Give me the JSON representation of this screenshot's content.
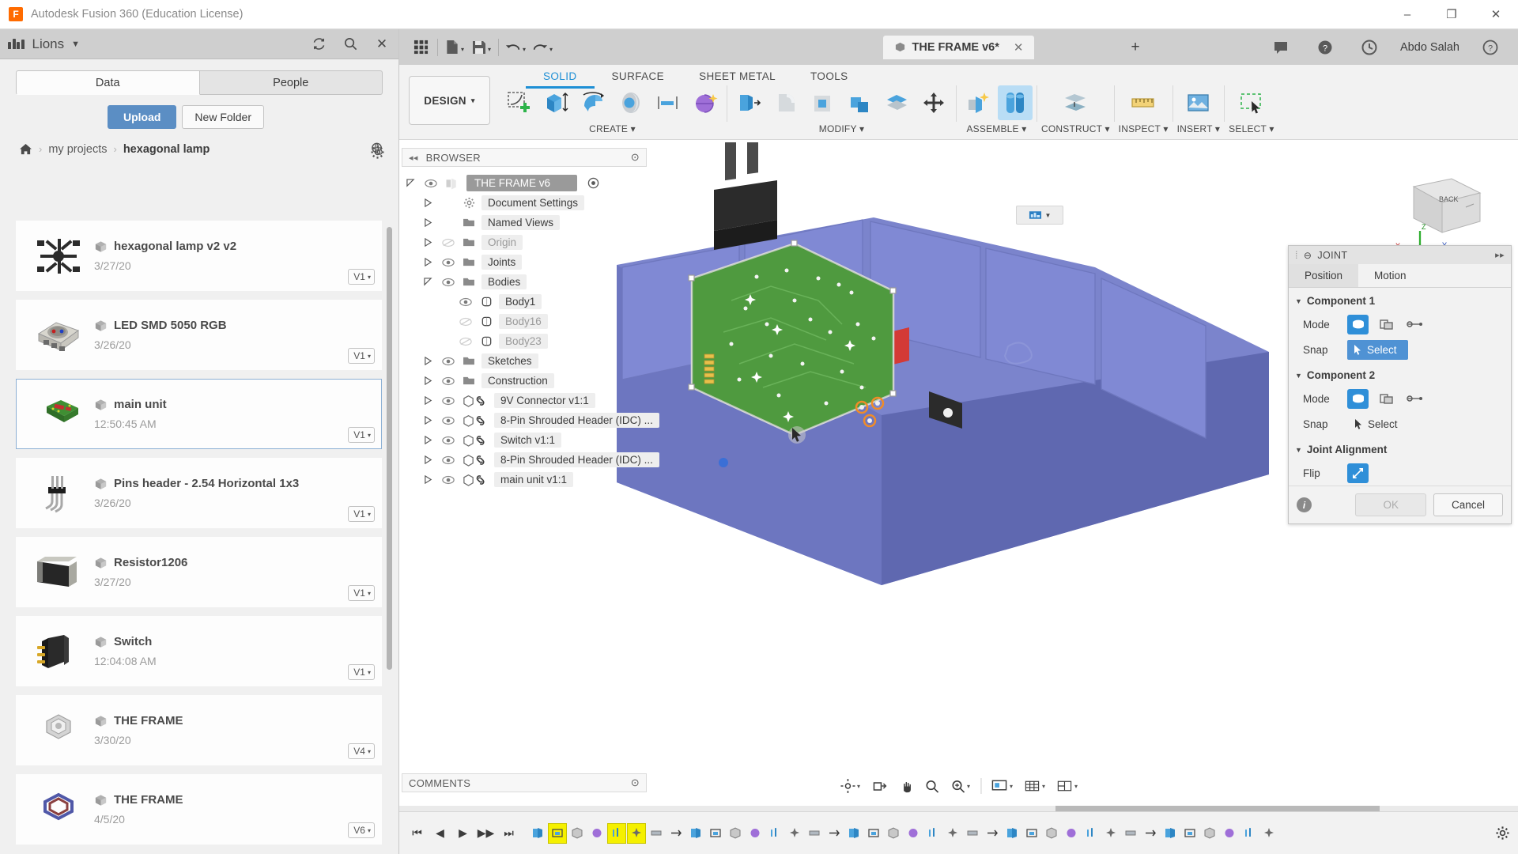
{
  "titlebar": {
    "app_title": "Autodesk Fusion 360 (Education License)",
    "logo_letter": "F",
    "minimize": "–",
    "maximize": "❐",
    "close": "✕"
  },
  "data_panel": {
    "hub_name": "Lions",
    "hub_caret": "▼",
    "refresh_icon": "refresh-icon",
    "search_icon": "search-icon",
    "close_icon": "✕",
    "tabs": [
      {
        "label": "Data",
        "active": true
      },
      {
        "label": "People",
        "active": false
      }
    ],
    "upload_label": "Upload",
    "new_folder_label": "New Folder",
    "breadcrumb": {
      "home": "⌂",
      "sep": "›",
      "project": "my projects",
      "current": "hexagonal lamp"
    },
    "items": [
      {
        "name": "hexagonal lamp v2 v2",
        "date": "3/27/20",
        "version": "V1",
        "selected": false,
        "thumb": "spider-assembly"
      },
      {
        "name": "LED SMD 5050 RGB",
        "date": "3/26/20",
        "version": "V1",
        "selected": false,
        "thumb": "led-package"
      },
      {
        "name": "main unit",
        "date": "12:50:45 AM",
        "version": "V1",
        "selected": true,
        "thumb": "green-pcb"
      },
      {
        "name": "Pins header - 2.54 Horizontal 1x3",
        "date": "3/26/20",
        "version": "V1",
        "selected": false,
        "thumb": "pin-header"
      },
      {
        "name": "Resistor1206",
        "date": "3/27/20",
        "version": "V1",
        "selected": false,
        "thumb": "resistor"
      },
      {
        "name": "Switch",
        "date": "12:04:08 AM",
        "version": "V1",
        "selected": false,
        "thumb": "switch"
      },
      {
        "name": "THE FRAME",
        "date": "3/30/20",
        "version": "V4",
        "selected": false,
        "thumb": "hex-frame-grey"
      },
      {
        "name": "THE FRAME",
        "date": "4/5/20",
        "version": "V6",
        "selected": false,
        "thumb": "hex-frame-blue"
      }
    ],
    "version_caret": "▾"
  },
  "quick_access": {
    "grid_icon": "grid-apps-icon",
    "new_icon": "new-document-icon",
    "save_icon": "save-icon",
    "undo_icon": "undo-icon",
    "redo_icon": "redo-icon",
    "document_tab": "THE FRAME v6*",
    "tab_close": "✕",
    "tab_add": "+",
    "comment_icon": "comment-icon",
    "help_icon": "help-icon",
    "notification_icon": "notification-icon",
    "user_name": "Abdo Salah",
    "user_help_icon": "question-icon"
  },
  "ribbon": {
    "workspace_label": "DESIGN",
    "workspace_caret": "▾",
    "tabs": [
      {
        "label": "SOLID",
        "active": true
      },
      {
        "label": "SURFACE",
        "active": false
      },
      {
        "label": "SHEET METAL",
        "active": false
      },
      {
        "label": "TOOLS",
        "active": false
      }
    ],
    "groups": [
      {
        "label": "CREATE ▾",
        "icons": [
          "sketch-create-icon",
          "extrude-icon",
          "revolve-icon",
          "sweep-icon",
          "rib-icon",
          "pattern-sphere-icon"
        ]
      },
      {
        "label": "MODIFY ▾",
        "icons": [
          "press-pull-icon",
          "fillet-icon",
          "shell-icon",
          "combine-icon",
          "offset-face-icon",
          "move-copy-icon"
        ]
      },
      {
        "label": "ASSEMBLE ▾",
        "icons": [
          "new-component-icon",
          "joint-icon"
        ]
      },
      {
        "label": "CONSTRUCT ▾",
        "icons": [
          "offset-plane-icon"
        ]
      },
      {
        "label": "INSPECT ▾",
        "icons": [
          "measure-icon"
        ]
      },
      {
        "label": "INSERT ▾",
        "icons": [
          "insert-image-icon"
        ]
      },
      {
        "label": "SELECT ▾",
        "icons": [
          "select-icon"
        ]
      }
    ]
  },
  "browser": {
    "title": "BROWSER",
    "collapse_icon": "◂◂",
    "settings_dot": "⊙",
    "tree": [
      {
        "label": "THE FRAME v6",
        "indent": 0,
        "arrow": "open",
        "eye": "on",
        "icon": "component-icon",
        "root": true,
        "dim": false
      },
      {
        "label": "Document Settings",
        "indent": 1,
        "arrow": "closed",
        "eye": "none",
        "icon": "gear-icon",
        "root": false,
        "dim": false
      },
      {
        "label": "Named Views",
        "indent": 1,
        "arrow": "closed",
        "eye": "none",
        "icon": "folder-icon",
        "root": false,
        "dim": false
      },
      {
        "label": "Origin",
        "indent": 1,
        "arrow": "closed",
        "eye": "off",
        "icon": "folder-icon",
        "root": false,
        "dim": true
      },
      {
        "label": "Joints",
        "indent": 1,
        "arrow": "closed",
        "eye": "on",
        "icon": "folder-icon",
        "root": false,
        "dim": false
      },
      {
        "label": "Bodies",
        "indent": 1,
        "arrow": "open",
        "eye": "on",
        "icon": "folder-icon",
        "root": false,
        "dim": false
      },
      {
        "label": "Body1",
        "indent": 2,
        "arrow": "none",
        "eye": "on",
        "icon": "body-icon",
        "root": false,
        "dim": false
      },
      {
        "label": "Body16",
        "indent": 2,
        "arrow": "none",
        "eye": "off",
        "icon": "body-icon",
        "root": false,
        "dim": true
      },
      {
        "label": "Body23",
        "indent": 2,
        "arrow": "none",
        "eye": "off",
        "icon": "body-icon",
        "root": false,
        "dim": true
      },
      {
        "label": "Sketches",
        "indent": 1,
        "arrow": "closed",
        "eye": "on",
        "icon": "folder-icon",
        "root": false,
        "dim": false
      },
      {
        "label": "Construction",
        "indent": 1,
        "arrow": "closed",
        "eye": "on",
        "icon": "folder-icon",
        "root": false,
        "dim": false
      },
      {
        "label": "9V Connector v1:1",
        "indent": 1,
        "arrow": "closed",
        "eye": "on",
        "icon": "component-link-icon",
        "root": false,
        "dim": false
      },
      {
        "label": "8-Pin Shrouded Header (IDC) ...",
        "indent": 1,
        "arrow": "closed",
        "eye": "on",
        "icon": "component-link-icon",
        "root": false,
        "dim": false
      },
      {
        "label": "Switch v1:1",
        "indent": 1,
        "arrow": "closed",
        "eye": "on",
        "icon": "component-link-icon",
        "root": false,
        "dim": false
      },
      {
        "label": "8-Pin Shrouded Header (IDC) ...",
        "indent": 1,
        "arrow": "closed",
        "eye": "on",
        "icon": "component-link-icon",
        "root": false,
        "dim": false
      },
      {
        "label": "main unit v1:1",
        "indent": 1,
        "arrow": "closed",
        "eye": "on",
        "icon": "component-link-icon",
        "root": false,
        "dim": false
      }
    ]
  },
  "joint_dialog": {
    "title": "JOINT",
    "grip_icon": "grip-icon",
    "close_icon": "⊝",
    "expand_icon": "▸▸",
    "tabs": [
      {
        "label": "Position",
        "active": true
      },
      {
        "label": "Motion",
        "active": false
      }
    ],
    "component1": {
      "section": "Component 1",
      "tri": "▼",
      "mode_label": "Mode",
      "snap_label": "Snap",
      "select_label": "Select",
      "select_active": true
    },
    "component2": {
      "section": "Component 2",
      "tri": "▼",
      "mode_label": "Mode",
      "snap_label": "Snap",
      "select_label": "Select",
      "select_active": false
    },
    "alignment": {
      "section": "Joint Alignment",
      "tri": "▼",
      "flip_label": "Flip"
    },
    "ok_label": "OK",
    "cancel_label": "Cancel",
    "info_icon": "i"
  },
  "viewport": {
    "display_chip_icon": "display-settings-icon",
    "display_chip_caret": "▼",
    "viewcube_back": "BACK",
    "axis_x": "X",
    "axis_y": "Y",
    "axis_z": "Z"
  },
  "comments": {
    "title": "COMMENTS",
    "dot": "⊙"
  },
  "nav_toolbar": {
    "icons": [
      "orbit-icon",
      "look-at-icon",
      "pan-icon",
      "zoom-icon",
      "zoom-window-icon",
      "display-settings-icon",
      "grid-snaps-icon",
      "viewports-icon"
    ],
    "carets": "▾"
  },
  "timeline": {
    "first": "⏮",
    "prev": "◀",
    "play": "▶",
    "next": "▶▶",
    "last": "⏭",
    "gear_icon": "timeline-settings-icon",
    "marked_nodes": [
      1,
      4,
      5
    ],
    "node_count": 38
  },
  "colors": {
    "accent_blue": "#2f8fd8",
    "tab_active_blue": "#1e8fd5",
    "upload_blue": "#5b8ec4",
    "model_blue": "#7b84cc",
    "pcb_green": "#4f9a3f",
    "highlight_yellow": "#f5f000",
    "panel_grey": "#f2f2f2",
    "titlebar_grey": "#cfcfcf"
  }
}
